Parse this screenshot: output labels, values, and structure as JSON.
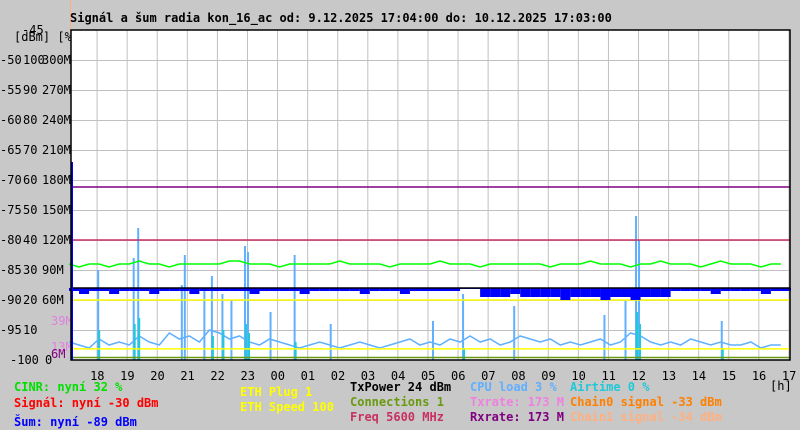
{
  "colors": {
    "background": "#c8c8c8",
    "plot_bg": "#ffffff",
    "grid": "#c0c0c0",
    "cinr": "#00ff00",
    "signal": "#ff0000",
    "noise": "#0000ff",
    "eth": "#ffff00",
    "txpower": "#000000",
    "connections": "#6a9a10",
    "freq": "#c83060",
    "cpu": "#60b0ff",
    "txrate": "#f080e0",
    "rxrate": "#800080",
    "airtime": "#20c8d8",
    "chain0": "#ff8000",
    "chain1": "#ffb080"
  },
  "chart_data": {
    "type": "line",
    "title": "Signál a šum radia kon_16_ac od: 9.12.2025 17:04:00 do: 10.12.2025 17:03:00",
    "y_axis_headers": [
      "-45",
      "[dBm] [%]"
    ],
    "x_unit": "[h]",
    "x_ticks": [
      "18",
      "19",
      "20",
      "21",
      "22",
      "23",
      "00",
      "01",
      "02",
      "03",
      "04",
      "05",
      "06",
      "07",
      "08",
      "09",
      "10",
      "11",
      "12",
      "13",
      "14",
      "15",
      "16",
      "17"
    ],
    "y_ticks_dbm": [
      "-50",
      "-55",
      "-60",
      "-65",
      "-70",
      "-75",
      "-80",
      "-85",
      "-90",
      "-95",
      "-100"
    ],
    "y_ticks_pct": [
      "100",
      "90",
      "80",
      "70",
      "60",
      "50",
      "40",
      "30",
      "20",
      "10",
      "0"
    ],
    "y_ticks_rate": [
      "300M",
      "270M",
      "240M",
      "210M",
      "180M",
      "150M",
      "120M",
      "90M",
      "60M"
    ],
    "extra_rate_labels": [
      {
        "label": "39M",
        "color": "#e080e0",
        "value": 39
      },
      {
        "label": "13M",
        "color": "#e080e0",
        "value": 13
      },
      {
        "label": "6M",
        "color": "#800080",
        "value": 6
      }
    ],
    "ylim_dbm": [
      -100,
      -45
    ],
    "ylim_pct": [
      0,
      110
    ],
    "ylim_rate_M": [
      0,
      330
    ],
    "x_start_hour_offset": 0.067,
    "series": {
      "rxrate_M": 173,
      "freq_level_dbm": -80,
      "noise_threshold_dbm": -88,
      "eth_speed_level_pct": 20,
      "eth_plug_level_pct": 3.7,
      "connections_level_pct": 1,
      "cinr_pct": [
        32,
        31,
        32,
        32,
        31,
        32,
        32,
        33,
        32,
        32,
        31,
        32,
        32,
        32,
        32,
        32,
        33,
        33,
        32,
        32,
        32,
        31,
        32,
        32,
        32,
        32,
        32,
        33,
        32,
        32,
        32,
        32,
        31,
        32,
        32,
        32,
        32,
        33,
        32,
        32,
        32,
        31,
        32,
        32,
        32,
        32,
        32,
        32,
        31,
        32,
        32,
        32,
        33,
        32,
        32,
        32,
        31,
        32,
        32,
        33,
        32,
        32,
        32,
        31,
        32,
        33,
        32,
        32,
        32,
        31,
        32,
        32
      ],
      "noise_dbm": [
        -88.5,
        -89,
        -88.5,
        -88.5,
        -89,
        -88.5,
        -88.5,
        -88.5,
        -89,
        -88.5,
        -88.5,
        -88.5,
        -89,
        -88.5,
        -88.5,
        -88.5,
        -88.5,
        -88.5,
        -89,
        -88.5,
        -88.5,
        -88.5,
        -88.5,
        -89,
        -88.5,
        -88.5,
        -88.5,
        -88.5,
        -88.5,
        -89,
        -88.5,
        -88.5,
        -88.5,
        -89,
        -88.5,
        -88.5,
        -88.5,
        -88.5,
        -88.5,
        -88,
        -88,
        -89.5,
        -89.5,
        -89.5,
        -89,
        -89.5,
        -89.5,
        -89.5,
        -89.5,
        -90,
        -89.5,
        -89.5,
        -89.5,
        -90,
        -89.5,
        -89.5,
        -90,
        -89.5,
        -89.5,
        -89.5,
        -88.5,
        -88.5,
        -88.5,
        -88.5,
        -89,
        -88.5,
        -88.5,
        -88.5,
        -88.5,
        -89,
        -88.5,
        -88.5
      ],
      "cpu_load_pct": [
        6,
        5,
        4,
        7,
        5,
        6,
        5,
        8,
        6,
        5,
        9,
        7,
        8,
        6,
        10,
        9,
        7,
        8,
        6,
        5,
        7,
        6,
        5,
        4,
        5,
        6,
        5,
        4,
        5,
        6,
        5,
        4,
        5,
        6,
        7,
        5,
        6,
        5,
        7,
        6,
        8,
        6,
        7,
        5,
        6,
        8,
        7,
        6,
        7,
        5,
        6,
        5,
        6,
        7,
        5,
        6,
        9,
        8,
        6,
        5,
        6,
        5,
        7,
        6,
        5,
        6,
        5,
        5,
        6,
        4,
        5,
        5
      ],
      "cpu_load_spikes": [
        [
          0.97,
          30
        ],
        [
          2.15,
          34
        ],
        [
          2.3,
          44
        ],
        [
          3.75,
          25
        ],
        [
          3.85,
          35
        ],
        [
          4.5,
          24
        ],
        [
          4.75,
          28
        ],
        [
          5.1,
          22
        ],
        [
          5.4,
          20
        ],
        [
          5.85,
          38
        ],
        [
          5.95,
          36
        ],
        [
          6.7,
          16
        ],
        [
          7.5,
          35
        ],
        [
          8.7,
          12
        ],
        [
          12.1,
          13
        ],
        [
          13.1,
          22
        ],
        [
          14.8,
          18
        ],
        [
          17.8,
          15
        ],
        [
          18.5,
          20
        ],
        [
          18.85,
          48
        ],
        [
          18.95,
          40
        ],
        [
          21.7,
          13
        ]
      ],
      "airtime_spikes": [
        [
          0.97,
          10
        ],
        [
          2.15,
          12
        ],
        [
          2.3,
          14
        ],
        [
          4.75,
          8
        ],
        [
          5.1,
          10
        ],
        [
          5.85,
          12
        ],
        [
          5.95,
          9
        ],
        [
          7.5,
          6
        ],
        [
          13.1,
          4
        ],
        [
          18.85,
          16
        ],
        [
          18.95,
          12
        ],
        [
          21.7,
          4
        ]
      ]
    }
  },
  "legend": {
    "cinr": "CINR: nyní 32 %",
    "signal": "Signál: nyní -30 dBm",
    "noise": "Šum: nyní -89 dBm",
    "eth_plug": "ETH Plug 1",
    "eth_speed": "ETH Speed 100",
    "txpower": "TxPower 24 dBm",
    "connections": "Connections 1",
    "freq": "Freq 5600 MHz",
    "cpu": "CPU load 3 %",
    "txrate": "Txrate: 173 M",
    "rxrate": "Rxrate: 173 M",
    "airtime": "Airtime 0 %",
    "chain0": "Chain0 signal -33 dBm",
    "chain1": "Chain1 signal -34 dBm"
  }
}
